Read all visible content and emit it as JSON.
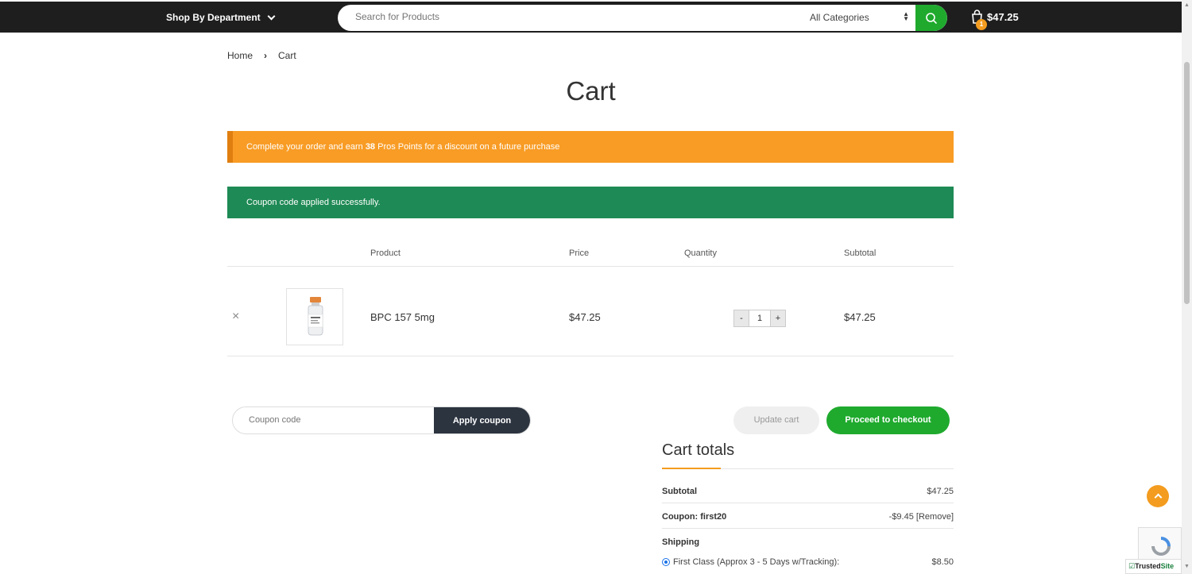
{
  "header": {
    "dept_label": "Shop By Department",
    "search_placeholder": "Search for Products",
    "category": "All Categories",
    "cart_total": "$47.25",
    "cart_count": "1"
  },
  "breadcrumb": {
    "home": "Home",
    "current": "Cart"
  },
  "page_title": "Cart",
  "notices": {
    "points_pre": "Complete your order and earn ",
    "points_value": "38",
    "points_post": " Pros Points for a discount on a future purchase",
    "coupon_applied": "Coupon code applied successfully."
  },
  "table": {
    "headers": {
      "product": "Product",
      "price": "Price",
      "quantity": "Quantity",
      "subtotal": "Subtotal"
    },
    "rows": [
      {
        "remove": "×",
        "name": "BPC 157 5mg",
        "price": "$47.25",
        "qty": "1",
        "subtotal": "$47.25"
      }
    ],
    "qty_minus": "-",
    "qty_plus": "+"
  },
  "coupon": {
    "placeholder": "Coupon code",
    "apply_label": "Apply coupon"
  },
  "actions": {
    "update": "Update cart",
    "checkout": "Proceed to checkout"
  },
  "totals": {
    "title": "Cart totals",
    "subtotal_label": "Subtotal",
    "subtotal_value": "$47.25",
    "coupon_label": "Coupon: first20",
    "coupon_value": "-$9.45",
    "coupon_remove": "[Remove]",
    "shipping_label": "Shipping",
    "shipping_option": "First Class (Approx 3 - 5 Days w/Tracking):",
    "shipping_value": "$8.50"
  },
  "badge": {
    "trusted": "Trusted",
    "site": "Site"
  },
  "colors": {
    "accent_green": "#1faa2e",
    "accent_orange": "#f89c25",
    "notice_green": "#1e8a55",
    "dark": "#1e1e1e"
  }
}
